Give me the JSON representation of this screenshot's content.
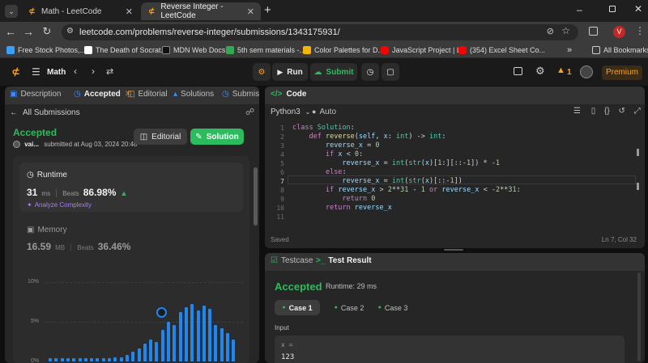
{
  "browser": {
    "tabs": [
      {
        "title": "Math - LeetCode",
        "active": false
      },
      {
        "title": "Reverse Integer - LeetCode",
        "active": true
      }
    ],
    "new_tab": "+",
    "url": "leetcode.com/problems/reverse-integer/submissions/1343175931/",
    "profile_initial": "V",
    "bookmarks": [
      {
        "label": "Free Stock Photos,...",
        "color": "#3aa0ff"
      },
      {
        "label": "The Death of Socrat...",
        "color": "#ffffff"
      },
      {
        "label": "MDN Web Docs",
        "color": "#111111"
      },
      {
        "label": "5th sem materials -...",
        "color": "#34a853"
      },
      {
        "label": "Color Palettes for D...",
        "color": "#f4b400"
      },
      {
        "label": "JavaScript Project | L...",
        "color": "#ff0000"
      },
      {
        "label": "(354) Excel Sheet Co...",
        "color": "#ff0000"
      }
    ],
    "all_bookmarks": "All Bookmarks",
    "more_bookmarks": "»"
  },
  "lc_topbar": {
    "problem_list": "Math",
    "run_label": "Run",
    "submit_label": "Submit",
    "streak_count": "1",
    "premium_label": "Premium"
  },
  "left_panel": {
    "tabs": [
      "Description",
      "Accepted",
      "Editorial",
      "Solutions",
      "Submis"
    ],
    "back_label": "All Submissions",
    "status": "Accepted",
    "user": "vai...",
    "submitted_at": "submitted at Aug 03, 2024 20:48",
    "editorial_btn": "Editorial",
    "solution_btn": "Solution",
    "runtime": {
      "title": "Runtime",
      "value": "31",
      "unit": "ms",
      "beats_label": "Beats",
      "beats_value": "86.98%",
      "analyze_label": "Analyze Complexity"
    },
    "memory": {
      "title": "Memory",
      "value": "16.59",
      "unit": "MB",
      "beats_label": "Beats",
      "beats_value": "36.46%"
    },
    "histogram": {
      "y_ticks": [
        "10%",
        "5%",
        "0%"
      ],
      "values": [
        0.4,
        0.4,
        0.4,
        0.4,
        0.4,
        0.4,
        0.4,
        0.4,
        0.4,
        0.4,
        0.4,
        0.5,
        0.5,
        0.8,
        1.2,
        1.6,
        2.2,
        2.8,
        2.4,
        4.0,
        5.0,
        4.6,
        6.2,
        6.8,
        7.2,
        6.4,
        7.0,
        6.6,
        4.6,
        4.2,
        3.6,
        2.8
      ]
    }
  },
  "code_panel": {
    "title": "Code",
    "language": "Python3",
    "auto_label": "Auto",
    "saved_label": "Saved",
    "position": "Ln 7, Col 32",
    "lines": [
      "class Solution:",
      "    def reverse(self, x: int) -> int:",
      "        reverse_x = 0",
      "        if x < 0:",
      "            reverse_x = int(str(x)[1:][::-1]) * -1",
      "        else:",
      "            reverse_x = int(str(x)[::-1])",
      "        if reverse_x > 2**31 - 1 or reverse_x < -2**31:",
      "            return 0",
      "        return reverse_x",
      ""
    ]
  },
  "result_panel": {
    "tabs": [
      "Testcase",
      "Test Result"
    ],
    "status": "Accepted",
    "runtime_text": "Runtime: 29 ms",
    "cases": [
      "Case 1",
      "Case 2",
      "Case 3"
    ],
    "input_label": "Input",
    "var_label": "x =",
    "input_value": "123"
  }
}
